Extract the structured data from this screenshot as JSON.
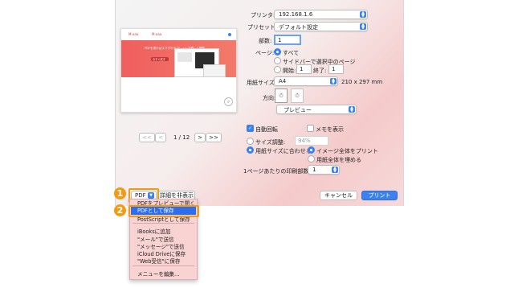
{
  "printer": {
    "label": "プリンタ:",
    "value": "192.168.1.6"
  },
  "presets": {
    "label": "プリセット:",
    "value": "デフォルト設定"
  },
  "copies": {
    "label": "部数:",
    "value": "1"
  },
  "pages": {
    "label": "ページ:",
    "all": "すべて",
    "selection": "サイドバーで選択中のページ",
    "from_label": "開始:",
    "from_value": "1",
    "to_label": "終了:",
    "to_value": "1"
  },
  "paper": {
    "label": "用紙サイズ:",
    "value": "A4",
    "dims": "210 x 297 mm"
  },
  "orientation": {
    "label": "方向:"
  },
  "section": {
    "value": "プレビュー"
  },
  "pager": {
    "text": "1 / 12",
    "first": "<<",
    "prev": "<",
    "next": ">",
    "last": ">>"
  },
  "options": {
    "auto_rotate": "自動回転",
    "show_notes": "メモを表示",
    "scale_label": "サイズ調整:",
    "scale_value": "94%",
    "fit_label": "用紙サイズに合わせる:",
    "print_entire": "イメージ全体をプリント",
    "fill_paper": "用紙全体を埋める",
    "copies_per_page_label": "1ページあたりの印刷部数:",
    "copies_per_page_value": "1"
  },
  "footer": {
    "pdf": "PDF",
    "hide_details": "詳細を非表示",
    "cancel": "キャンセル",
    "print": "プリント"
  },
  "pdf_menu": {
    "partial_top": "PDFをプレビューで開く",
    "save_pdf": "PDFとして保存",
    "save_ps": "PostScriptとして保存",
    "ibooks": "iBooksに追加",
    "mail": "\"メール\"で送信",
    "messages": "\"メッセージ\"で送信",
    "icloud": "iCloud Driveに保存",
    "web": "\"Web受信\"に保存",
    "edit": "メニューを編集..."
  },
  "steps": {
    "one": "1",
    "two": "2"
  },
  "colors": {
    "accent": "#3b82f0",
    "step_badge": "#f29a14",
    "menu_bg": "#f9d2d2",
    "selected": "#2d6ef0"
  },
  "preview_thumb": {
    "logo_left": "M-aaa",
    "logo_right": "M-aaa",
    "headline": "PDFを書けばスマホやタブレットで美しく閲覧",
    "button": "今すぐ試す"
  }
}
